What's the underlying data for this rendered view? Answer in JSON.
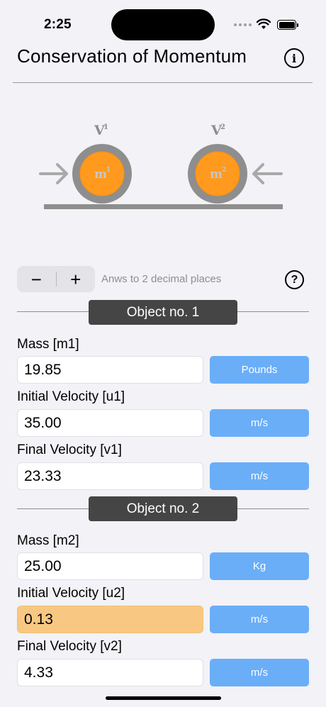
{
  "status_bar": {
    "time": "2:25"
  },
  "header": {
    "title": "Conservation of Momentum",
    "info_icon": "info-icon"
  },
  "diagram": {
    "v1_label": "V",
    "v1_sup": "1",
    "v2_label": "V",
    "v2_sup": "2",
    "m1_label": "m",
    "m1_sup": "1",
    "m2_label": "m",
    "m2_sup": "2",
    "colors": {
      "ring": "#8e8e8e",
      "ball": "#ff9a1f",
      "ground": "#8e8e8e",
      "arrow": "#a9a9a9"
    }
  },
  "controls": {
    "decrement": "−",
    "increment": "+",
    "precision_text": "Anws to 2 decimal places",
    "help": "?"
  },
  "object1": {
    "header": "Object no. 1",
    "mass": {
      "label": "Mass [m1]",
      "value": "19.85",
      "unit": "Pounds"
    },
    "initial_velocity": {
      "label": "Initial Velocity [u1]",
      "value": "35.00",
      "unit": "m/s"
    },
    "final_velocity": {
      "label": "Final Velocity [v1]",
      "value": "23.33",
      "unit": "m/s"
    }
  },
  "object2": {
    "header": "Object no. 2",
    "mass": {
      "label": "Mass [m2]",
      "value": "25.00",
      "unit": "Kg"
    },
    "initial_velocity": {
      "label": "Initial Velocity [u2]",
      "value": "0.13",
      "unit": "m/s"
    },
    "final_velocity": {
      "label": "Final Velocity [v2]",
      "value": "4.33",
      "unit": "m/s"
    }
  },
  "colors": {
    "accent": "#6aaef8",
    "highlight": "#f8c883",
    "section_bg": "#454545"
  }
}
